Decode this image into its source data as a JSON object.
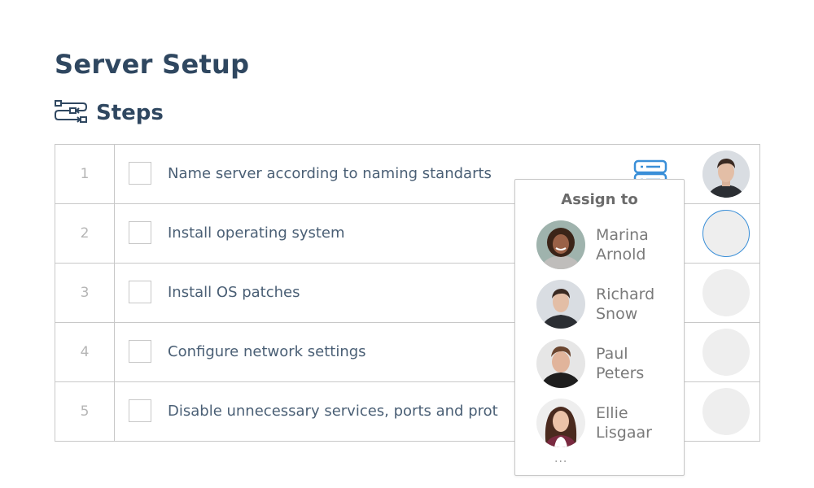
{
  "page": {
    "title": "Server Setup"
  },
  "section": {
    "icon": "workflow-steps-icon",
    "label": "Steps"
  },
  "steps": [
    {
      "number": "1",
      "label": "Name server according to naming standarts",
      "assignee": "Richard Snow"
    },
    {
      "number": "2",
      "label": "Install operating system",
      "assignee": ""
    },
    {
      "number": "3",
      "label": "Install OS patches",
      "assignee": ""
    },
    {
      "number": "4",
      "label": "Configure network settings",
      "assignee": ""
    },
    {
      "number": "5",
      "label": "Disable unnecessary services, ports and prot",
      "assignee": ""
    }
  ],
  "row_icon": "server-icon",
  "popover": {
    "title": "Assign to",
    "people": [
      {
        "first": "Marina",
        "last": "Arnold"
      },
      {
        "first": "Richard",
        "last": "Snow"
      },
      {
        "first": "Paul",
        "last": "Peters"
      },
      {
        "first": "Ellie",
        "last": "Lisgaar"
      }
    ],
    "more": "..."
  },
  "colors": {
    "accent": "#3a8fd8",
    "heading": "#2f4760",
    "border": "#c8c8c8"
  }
}
